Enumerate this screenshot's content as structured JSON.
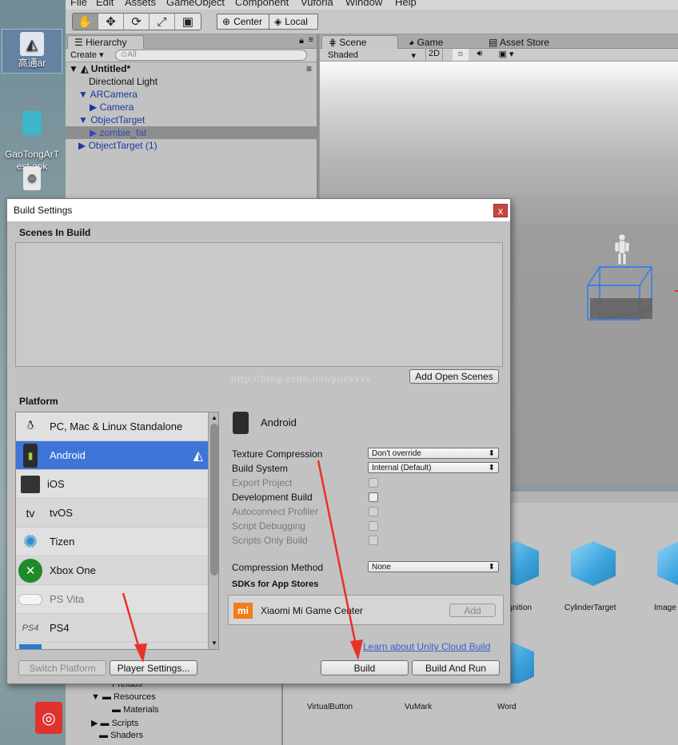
{
  "menubar": [
    "File",
    "Edit",
    "Assets",
    "GameObject",
    "Component",
    "Vuforia",
    "Window",
    "Help"
  ],
  "toolbar": {
    "center_label": "Center",
    "local_label": "Local"
  },
  "desktop": {
    "icons": [
      {
        "label": "高通ar"
      },
      {
        "label": "GaoTongArT\nest.apk"
      }
    ]
  },
  "hierarchy": {
    "tab": "Hierarchy",
    "create_label": "Create",
    "search_placeholder": "All",
    "scene_name": "Untitled*",
    "rows": [
      {
        "label": "Directional Light"
      },
      {
        "label": "ARCamera"
      },
      {
        "label": "Camera"
      },
      {
        "label": "ObjectTarget"
      },
      {
        "label": "zombie_fat"
      },
      {
        "label": "ObjectTarget (1)"
      }
    ]
  },
  "scene": {
    "tabs": [
      "Scene",
      "Game",
      "Asset Store"
    ],
    "shading": "Shaded",
    "mode_2d": "2D"
  },
  "project": {
    "folders": [
      "Prefabs",
      "Resources",
      "Materials",
      "Scripts",
      "Shaders"
    ],
    "assets_top": [
      "ognition",
      "CylinderTarget",
      "Image"
    ],
    "assets_bottom": [
      "VirtualButton",
      "VuMark",
      "Word"
    ]
  },
  "dialog": {
    "title": "Build Settings",
    "close": "x",
    "scenes_header": "Scenes In Build",
    "add_open_scenes": "Add Open Scenes",
    "watermark": "http://blog.csdn.net/yuxxxxx",
    "platform_header": "Platform",
    "platforms": [
      {
        "label": "PC, Mac & Linux Standalone",
        "icon": "standalone-icon"
      },
      {
        "label": "Android",
        "icon": "android-icon"
      },
      {
        "label": "iOS",
        "icon": "ios-icon"
      },
      {
        "label": "tvOS",
        "icon": "tvos-icon"
      },
      {
        "label": "Tizen",
        "icon": "tizen-icon"
      },
      {
        "label": "Xbox One",
        "icon": "xbox-icon"
      },
      {
        "label": "PS Vita",
        "icon": "psvita-icon"
      },
      {
        "label": "PS4",
        "icon": "ps4-icon"
      }
    ],
    "selected_platform": "Android",
    "settings": {
      "texture_compression_label": "Texture Compression",
      "texture_compression_value": "Don't override",
      "build_system_label": "Build System",
      "build_system_value": "Internal (Default)",
      "export_project": "Export Project",
      "development_build": "Development Build",
      "autoconnect_profiler": "Autoconnect Profiler",
      "script_debugging": "Script Debugging",
      "scripts_only_build": "Scripts Only Build",
      "compression_method_label": "Compression Method",
      "compression_method_value": "None",
      "sdks_header": "SDKs for App Stores",
      "sdk_name": "Xiaomi Mi Game Center",
      "sdk_add": "Add"
    },
    "cloud_link": "Learn about Unity Cloud Build",
    "buttons": {
      "switch_platform": "Switch Platform",
      "player_settings": "Player Settings...",
      "build": "Build",
      "build_and_run": "Build And Run"
    }
  },
  "colors": {
    "selection": "#3f74d8",
    "annotation_arrow": "#e8322a"
  }
}
